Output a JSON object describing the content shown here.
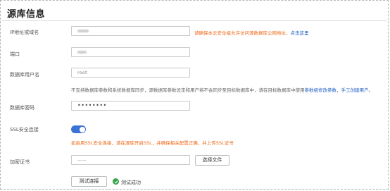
{
  "section_title": "源库信息",
  "fields": {
    "ip": {
      "label": "IP地址或域名",
      "hint_orange": "请确保本云安全组允许访问源数据库公网地址，",
      "hint_link": "点击这里"
    },
    "port": {
      "label": "端口"
    },
    "username": {
      "label": "数据库用户名",
      "value": "root",
      "hint_part1": "不支持数据库参数和系统数据库同步，源数据库参数设定和用户将不会同步至目标数据库中，请在目标数据库中使用",
      "hint_link1": "参数组修改参数",
      "hint_part2": "，",
      "hint_link2": "手工创建用户",
      "hint_part3": "。"
    },
    "password": {
      "label": "数据库密码",
      "value": "••••••••"
    },
    "ssl": {
      "label": "SSL安全连接",
      "enabled": true,
      "hint": "如启用SSL安全连接，请在源库开启SSL，并确保相关配置正确，并上传SSL证书"
    },
    "cert": {
      "label": "加密证书",
      "placeholder": "——",
      "choose_file_label": "选择文件"
    }
  },
  "test": {
    "button_label": "测试连接",
    "status_text": "测试成功",
    "status_color": "#3aa34a"
  },
  "colors": {
    "accent": "#3b72d6",
    "warning": "#ed6a1a",
    "link": "#1f5fc4"
  }
}
